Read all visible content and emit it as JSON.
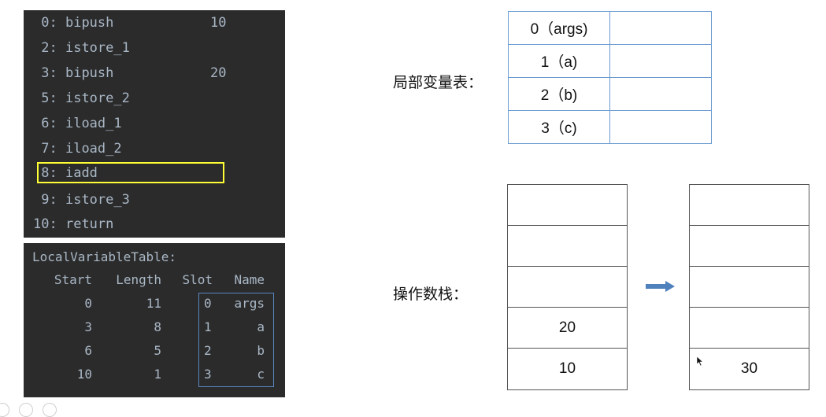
{
  "bytecode": [
    {
      "offset": " 0:",
      "op": "bipush",
      "arg": "10"
    },
    {
      "offset": " 2:",
      "op": "istore_1",
      "arg": ""
    },
    {
      "offset": " 3:",
      "op": "bipush",
      "arg": "20"
    },
    {
      "offset": " 5:",
      "op": "istore_2",
      "arg": ""
    },
    {
      "offset": " 6:",
      "op": "iload_1",
      "arg": ""
    },
    {
      "offset": " 7:",
      "op": "iload_2",
      "arg": ""
    },
    {
      "offset": " 8:",
      "op": "iadd",
      "arg": ""
    },
    {
      "offset": " 9:",
      "op": "istore_3",
      "arg": ""
    },
    {
      "offset": "10:",
      "op": "return",
      "arg": ""
    }
  ],
  "highlighted_instruction": "8: iadd",
  "local_variable_table": {
    "title": "LocalVariableTable:",
    "headers": {
      "start": "Start",
      "length": "Length",
      "slot": "Slot",
      "name": "Name"
    },
    "rows": [
      {
        "start": "0",
        "length": "11",
        "slot": "0",
        "name": "args"
      },
      {
        "start": "3",
        "length": "8",
        "slot": "1",
        "name": "a"
      },
      {
        "start": "6",
        "length": "5",
        "slot": "2",
        "name": "b"
      },
      {
        "start": "10",
        "length": "1",
        "slot": "3",
        "name": "c"
      }
    ]
  },
  "labels": {
    "local_var_table": "局部变量表：",
    "operand_stack": "操作数栈："
  },
  "lv_slots": [
    {
      "slot": "0（args)",
      "value": ""
    },
    {
      "slot": "1（a)",
      "value": ""
    },
    {
      "slot": "2（b)",
      "value": ""
    },
    {
      "slot": "3（c)",
      "value": ""
    }
  ],
  "stack_before": [
    "",
    "",
    "",
    "20",
    "10"
  ],
  "stack_after": [
    "",
    "",
    "",
    "",
    "30"
  ],
  "colors": {
    "code_bg": "#2b2b2b",
    "code_text": "#a9b7c6",
    "highlight": "#ffff33",
    "slot_box": "#5a86c4",
    "arrow": "#4f81bd"
  }
}
